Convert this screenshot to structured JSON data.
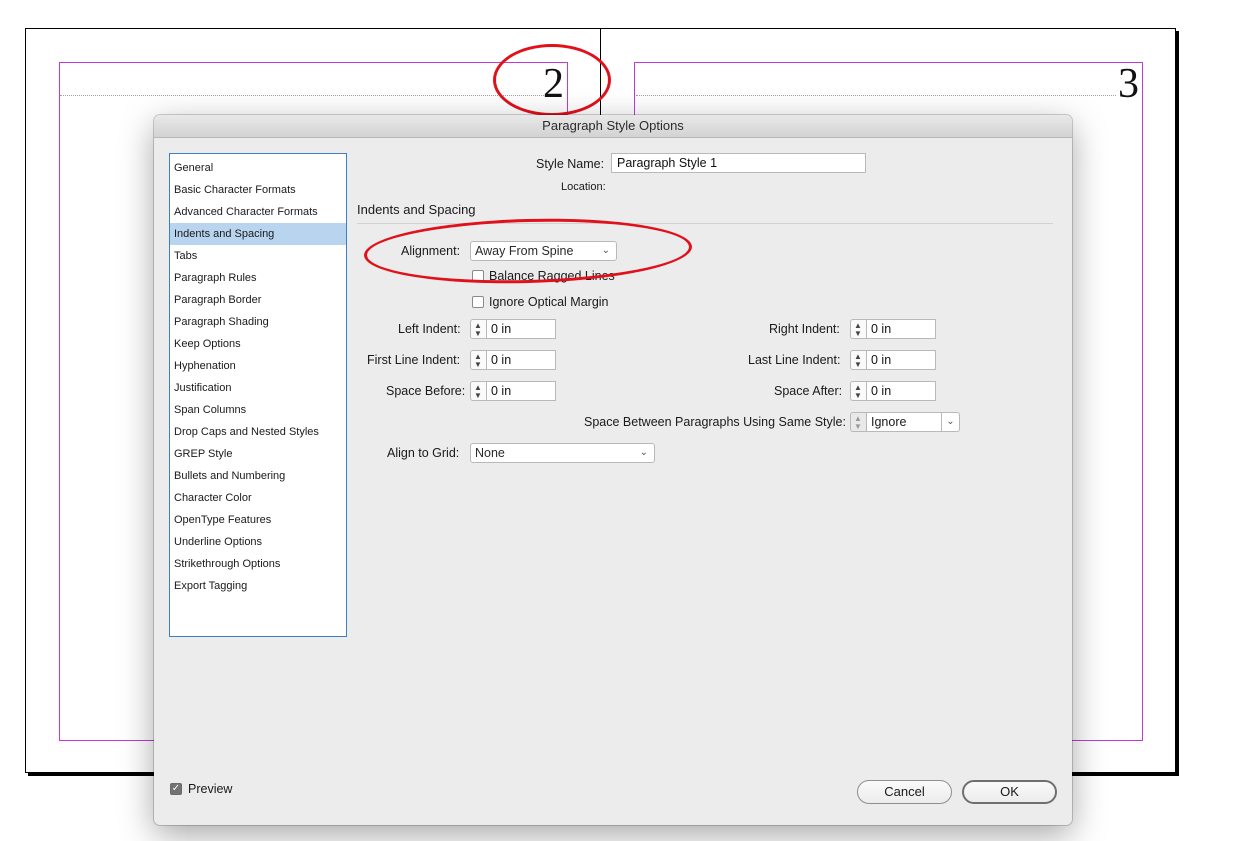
{
  "document": {
    "left_page_number": "2",
    "right_page_number": "3"
  },
  "dialog": {
    "title": "Paragraph Style Options",
    "nav_items": [
      "General",
      "Basic Character Formats",
      "Advanced Character Formats",
      "Indents and Spacing",
      "Tabs",
      "Paragraph Rules",
      "Paragraph Border",
      "Paragraph Shading",
      "Keep Options",
      "Hyphenation",
      "Justification",
      "Span Columns",
      "Drop Caps and Nested Styles",
      "GREP Style",
      "Bullets and Numbering",
      "Character Color",
      "OpenType Features",
      "Underline Options",
      "Strikethrough Options",
      "Export Tagging"
    ],
    "selected_nav_index": 3,
    "style_name_label": "Style Name:",
    "style_name_value": "Paragraph Style 1",
    "location_label": "Location:",
    "section_title": "Indents and Spacing",
    "alignment_label": "Alignment:",
    "alignment_value": "Away From Spine",
    "balance_ragged_label": "Balance Ragged Lines",
    "balance_ragged_checked": false,
    "ignore_optical_label": "Ignore Optical Margin",
    "ignore_optical_checked": false,
    "left_indent_label": "Left Indent:",
    "left_indent_value": "0 in",
    "first_line_indent_label": "First Line Indent:",
    "first_line_indent_value": "0 in",
    "space_before_label": "Space Before:",
    "space_before_value": "0 in",
    "right_indent_label": "Right Indent:",
    "right_indent_value": "0 in",
    "last_line_indent_label": "Last Line Indent:",
    "last_line_indent_value": "0 in",
    "space_after_label": "Space After:",
    "space_after_value": "0 in",
    "space_between_label": "Space Between Paragraphs Using Same Style:",
    "space_between_value": "Ignore",
    "align_to_grid_label": "Align to Grid:",
    "align_to_grid_value": "None",
    "preview_label": "Preview",
    "preview_checked": true,
    "cancel_label": "Cancel",
    "ok_label": "OK"
  },
  "colors": {
    "margin_guides": "#c13ad7",
    "annotation_red": "#e0111b",
    "selected_nav": "#b9d4ef",
    "nav_border": "#3d7fbf"
  }
}
